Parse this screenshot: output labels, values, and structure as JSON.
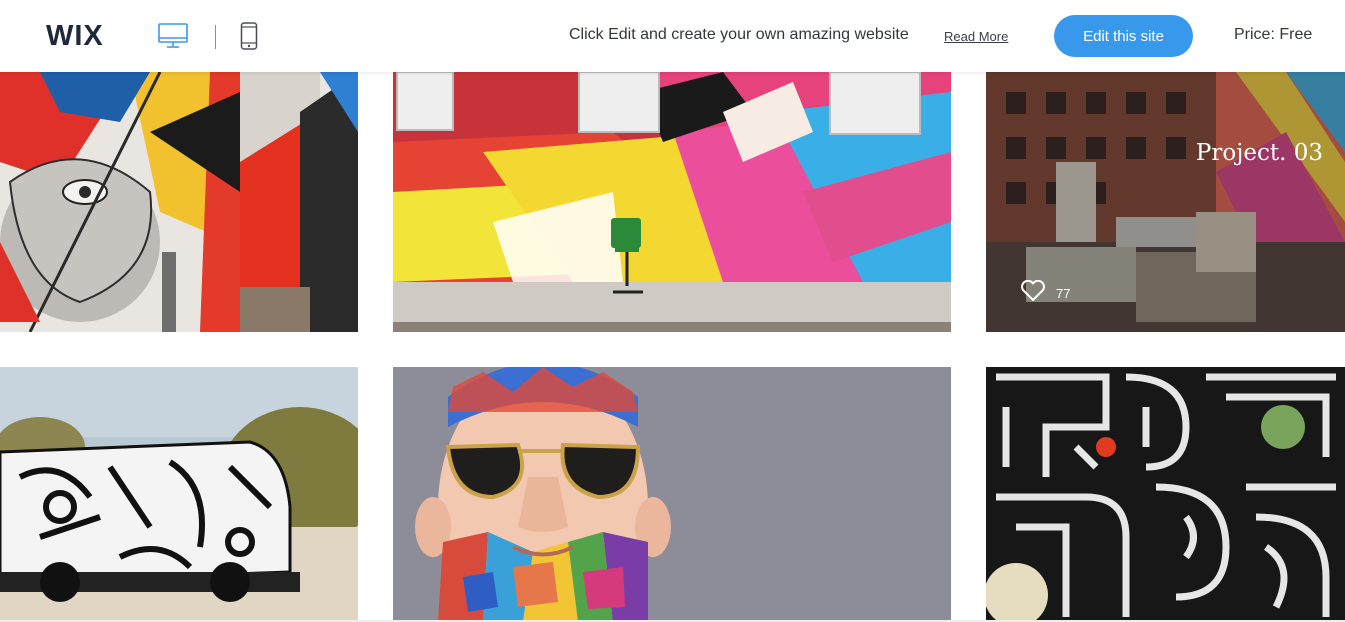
{
  "header": {
    "logo_text": "WIX",
    "device_icons": [
      "desktop-icon",
      "mobile-icon"
    ],
    "promo_text": "Click Edit and create your own amazing website",
    "read_more": "Read More",
    "edit_button": "Edit this site",
    "price": "Price: Free"
  },
  "colors": {
    "accent": "#3899ec",
    "text": "#32373e"
  },
  "gallery": {
    "tiles": [
      {
        "name": "mural-heart"
      },
      {
        "name": "mural-chair"
      },
      {
        "name": "mural-street",
        "title": "Project. 03",
        "likes": "77"
      },
      {
        "name": "mural-van"
      },
      {
        "name": "mural-beard-face"
      },
      {
        "name": "mural-maze"
      }
    ]
  }
}
